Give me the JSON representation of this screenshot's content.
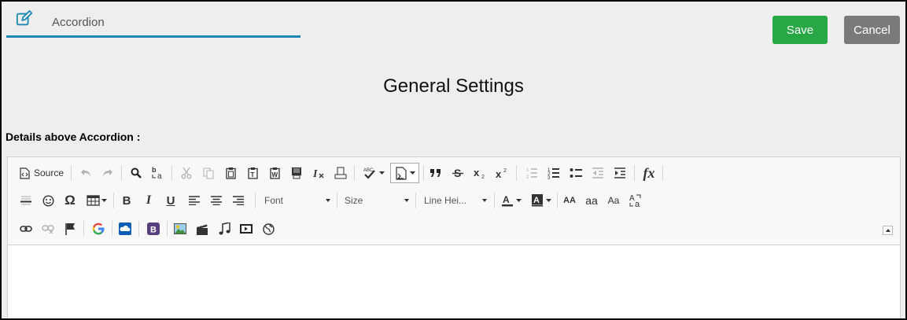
{
  "header": {
    "tab_title": "Accordion",
    "save_label": "Save",
    "cancel_label": "Cancel"
  },
  "main": {
    "section_title": "General Settings",
    "details_label": "Details above Accordion :"
  },
  "editor": {
    "toolbar": {
      "source_label": "Source",
      "font_combo": "Font",
      "size_combo": "Size",
      "line_height_combo": "Line Hei...",
      "font_size_big": "AA",
      "font_size_small": "aa",
      "font_case": "Aa",
      "formula_label": "fx"
    }
  },
  "colors": {
    "accent": "#1e88b4",
    "save": "#28a745",
    "cancel": "#7a7a7a"
  }
}
